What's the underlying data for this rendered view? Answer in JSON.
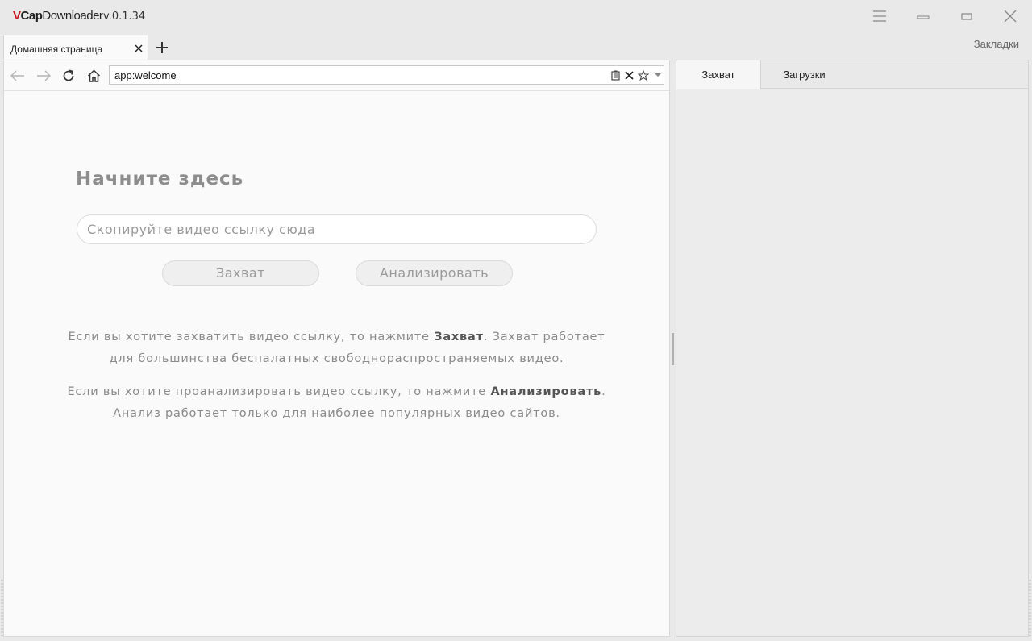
{
  "app": {
    "logo_v": "V",
    "logo_cap": "Cap",
    "logo_rest": "Downloader",
    "version": "v.0.1.34"
  },
  "window_controls": [
    "menu-icon",
    "minimize-icon",
    "maximize-icon",
    "close-icon"
  ],
  "tabs": [
    {
      "label": "Домашняя страница"
    }
  ],
  "bookmarks_label": "Закладки",
  "addressbar": {
    "url": "app:welcome"
  },
  "welcome": {
    "heading": "Начните здесь",
    "input_placeholder": "Скопируйте видео ссылку сюда",
    "capture_button": "Захват",
    "analyze_button": "Анализировать",
    "info1_before": "Если вы хотите захватить видео ссылку, то нажмите ",
    "info1_bold": "Захват",
    "info1_after": ". Захват работает для большинства беспалатных свободнораспространяемых видео.",
    "info2_before": "Если вы хотите проанализировать видео ссылку, то нажмите ",
    "info2_bold": "Анализировать",
    "info2_after": ". Анализ работает только для наиболее популярных видео сайтов."
  },
  "right_panel": {
    "tabs": [
      {
        "label": "Захват"
      },
      {
        "label": "Загрузки"
      }
    ]
  }
}
